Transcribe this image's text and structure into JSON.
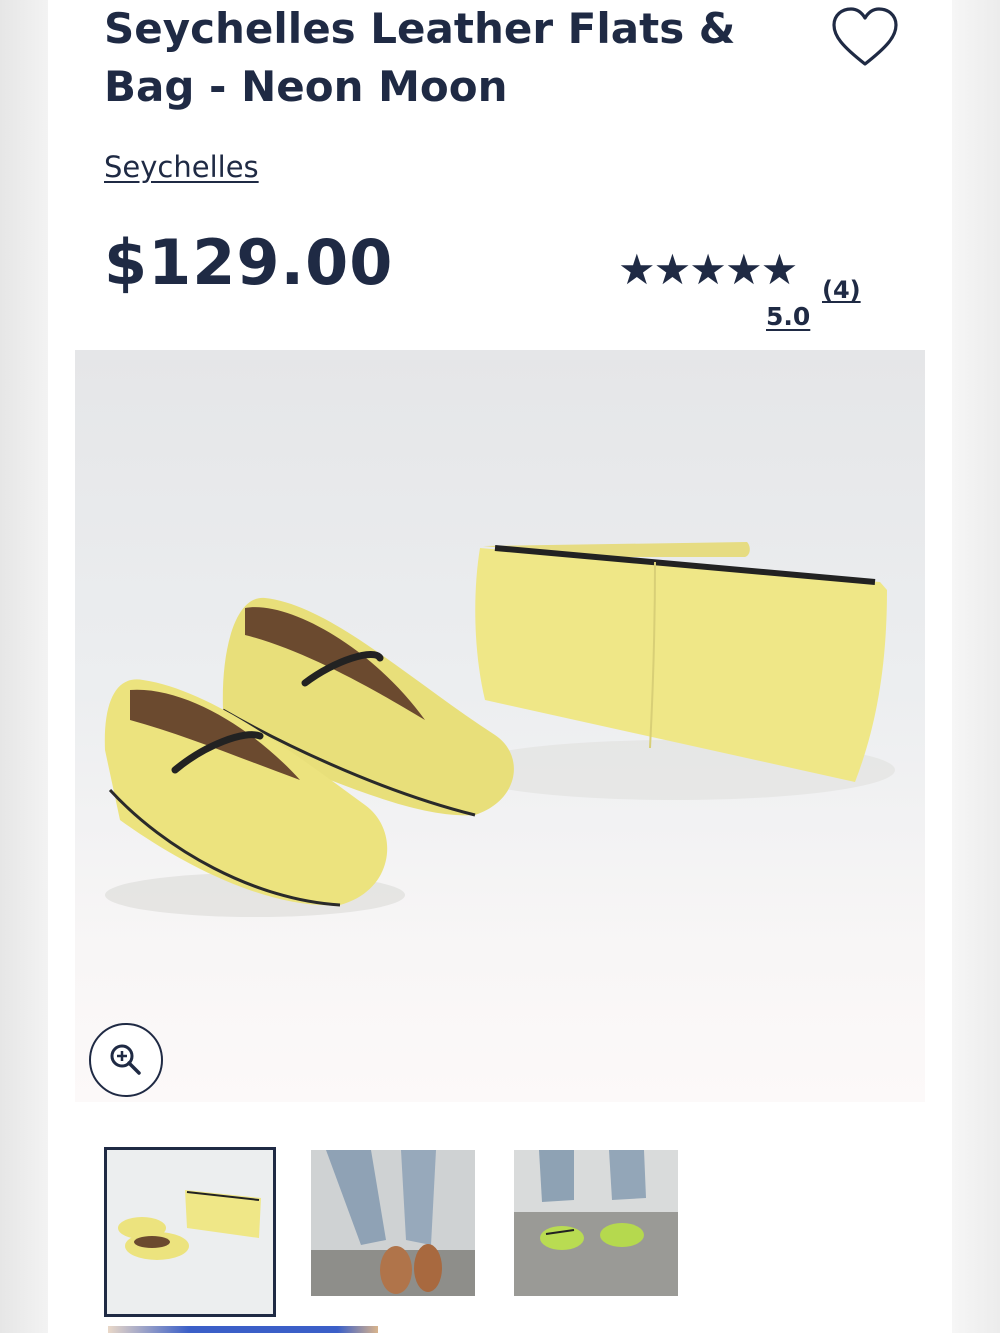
{
  "product": {
    "title": "Seychelles Leather Flats & Bag - Neon Moon",
    "brand": "Seychelles",
    "price": "$129.00",
    "rating": {
      "stars": "★★★★★",
      "count": "(4)",
      "score": "5.0"
    }
  },
  "icons": {
    "wishlist": "heart-outline-icon",
    "zoom": "zoom-in-icon"
  },
  "gallery": {
    "selected_index": 0,
    "thumbnails": [
      {
        "subject": "yellow flats and clutch"
      },
      {
        "subject": "brown flats worn with jeans"
      },
      {
        "subject": "green flats worn with jeans"
      }
    ]
  },
  "colors": {
    "text": "#1f2a44",
    "product_yellow": "#ece07c",
    "background": "#ffffff"
  }
}
